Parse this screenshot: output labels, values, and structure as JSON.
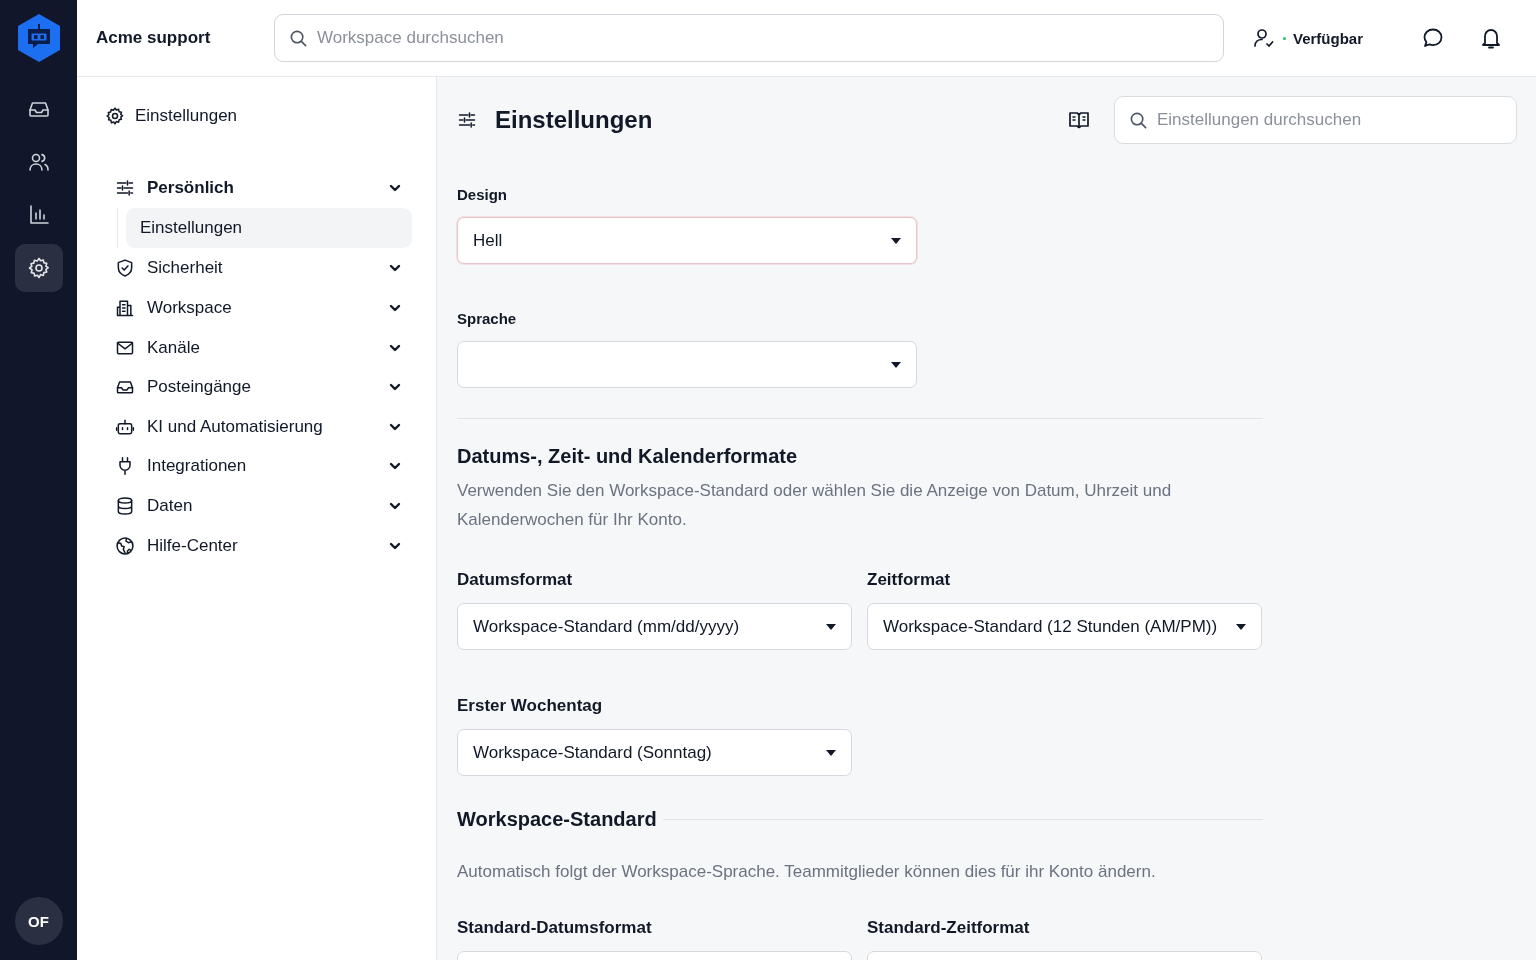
{
  "topbar": {
    "workspace": "Acme support",
    "search_placeholder": "Workspace durchsuchen",
    "status": "Verfügbar"
  },
  "rail": {
    "items": [
      {
        "selected": false
      },
      {
        "selected": false
      },
      {
        "selected": false
      },
      {
        "selected": true
      }
    ],
    "avatar": "OF"
  },
  "sidebar": {
    "title": "Einstellungen",
    "items": [
      {
        "label": "Persönlich",
        "expanded": true,
        "children": [
          {
            "label": "Einstellungen",
            "selected": true
          }
        ]
      },
      {
        "label": "Sicherheit",
        "expanded": false
      },
      {
        "label": "Workspace",
        "expanded": false
      },
      {
        "label": "Kanäle",
        "expanded": false
      },
      {
        "label": "Posteingänge",
        "expanded": false
      },
      {
        "label": "KI und Automatisierung",
        "expanded": false
      },
      {
        "label": "Integrationen",
        "expanded": false
      },
      {
        "label": "Daten",
        "expanded": false
      },
      {
        "label": "Hilfe-Center",
        "expanded": false
      }
    ]
  },
  "main": {
    "title": "Einstellungen",
    "search_placeholder": "Einstellungen durchsuchen",
    "blocks": [
      {
        "kind": "fields",
        "fields": [
          {
            "label": "Design",
            "value": "Hell",
            "focused": true
          }
        ]
      },
      {
        "kind": "fields",
        "fields": [
          {
            "label": "Sprache",
            "focused": false
          }
        ]
      },
      {
        "kind": "section",
        "title": "Datums-, Zeit- und Kalenderformate",
        "description": "Verwenden Sie den Workspace-Standard oder wählen Sie die Anzeige von Datum, Uhrzeit und Kalenderwochen für Ihr Konto."
      },
      {
        "kind": "fields",
        "fields": [
          {
            "label": "Datumsformat",
            "value": "Workspace-Standard (mm/dd/yyyy)",
            "focused": false
          },
          {
            "label": "Zeitformat",
            "value": "Workspace-Standard (12 Stunden (AM/PM))",
            "focused": false
          }
        ]
      },
      {
        "kind": "fields",
        "fields": [
          {
            "label": "Erster Wochentag",
            "value": "Workspace-Standard (Sonntag)",
            "focused": false
          }
        ]
      },
      {
        "kind": "inline-section",
        "title": "Workspace-Standard",
        "description": "Automatisch folgt der Workspace-Sprache. Teammitglieder können dies für ihr Konto ändern."
      },
      {
        "kind": "fields",
        "fields": [
          {
            "label": "Standard-Datumsformat",
            "focused": false
          },
          {
            "label": "Standard-Zeitformat",
            "focused": false
          }
        ]
      }
    ]
  }
}
